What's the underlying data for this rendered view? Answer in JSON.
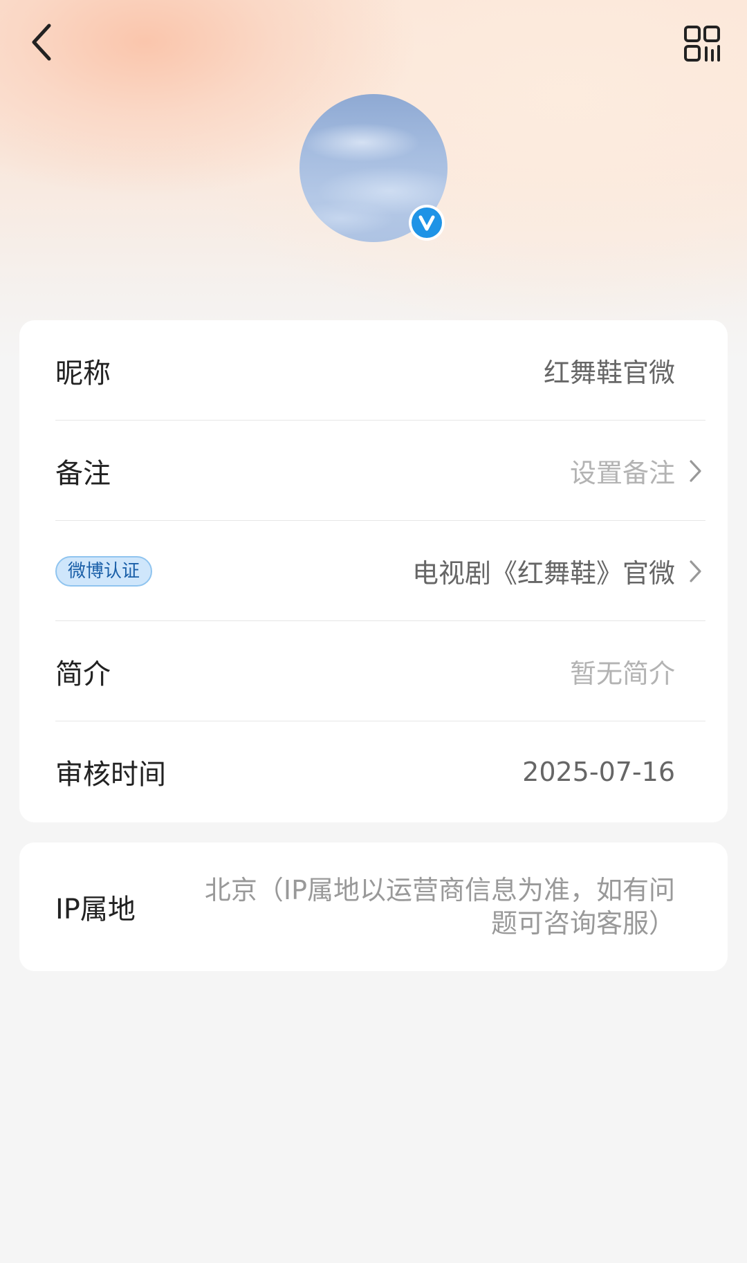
{
  "header": {
    "back_icon": "chevron-left-icon",
    "qr_icon": "qr-code-icon"
  },
  "profile": {
    "avatar_image": "sky-clouds",
    "verified_icon": "verified-v-icon",
    "verified_letter": "V",
    "badge_color": "#1e93e6"
  },
  "info": {
    "nickname_label": "昵称",
    "nickname_value": "红舞鞋官微",
    "remark_label": "备注",
    "remark_value": "设置备注",
    "verification_tag": "微博认证",
    "verification_value": "电视剧《红舞鞋》官微",
    "bio_label": "简介",
    "bio_value": "暂无简介",
    "review_time_label": "审核时间",
    "review_time_value": "2025-07-16"
  },
  "ip": {
    "label": "IP属地",
    "value": "北京（IP属地以运营商信息为准，如有问题可咨询客服）"
  },
  "colors": {
    "tag_background": "#cfe6fb",
    "tag_text": "#1a5fa8"
  }
}
